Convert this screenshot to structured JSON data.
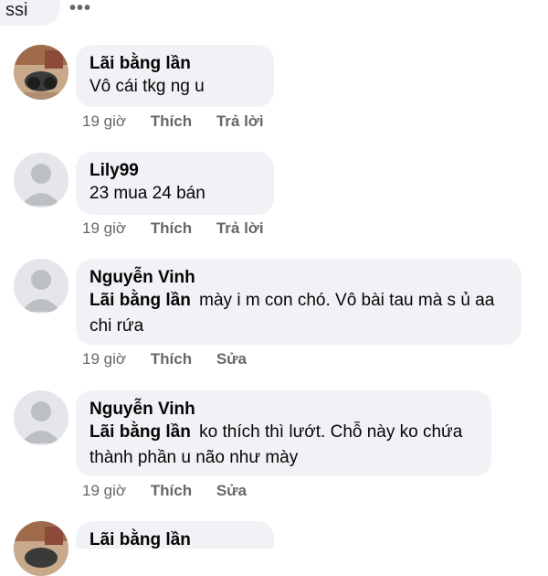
{
  "top": {
    "partial_text": "ssi",
    "more": "•••"
  },
  "comments": [
    {
      "author": "Lãi bằng lần",
      "mention": "",
      "text": "Vô cái tkg ng u",
      "time": "19 giờ",
      "like": "Thích",
      "action": "Trả lời"
    },
    {
      "author": "Lily99",
      "mention": "",
      "text": "23 mua 24 bán",
      "time": "19 giờ",
      "like": "Thích",
      "action": "Trả lời"
    },
    {
      "author": "Nguyễn Vinh",
      "mention": "Lãi bằng lần",
      "text": "mày i m con chó. Vô bài tau mà s ủ aa chi rứa",
      "time": "19 giờ",
      "like": "Thích",
      "action": "Sửa"
    },
    {
      "author": "Nguyễn Vinh",
      "mention": "Lãi bằng lần",
      "text": "ko thích thì lướt. Chỗ này ko chứa thành phần u não như mày",
      "time": "19 giờ",
      "like": "Thích",
      "action": "Sửa"
    },
    {
      "author": "Lãi bằng lần"
    }
  ],
  "colors": {
    "bubble": "#f0f2f5",
    "meta": "#65676b",
    "text": "#050505"
  }
}
